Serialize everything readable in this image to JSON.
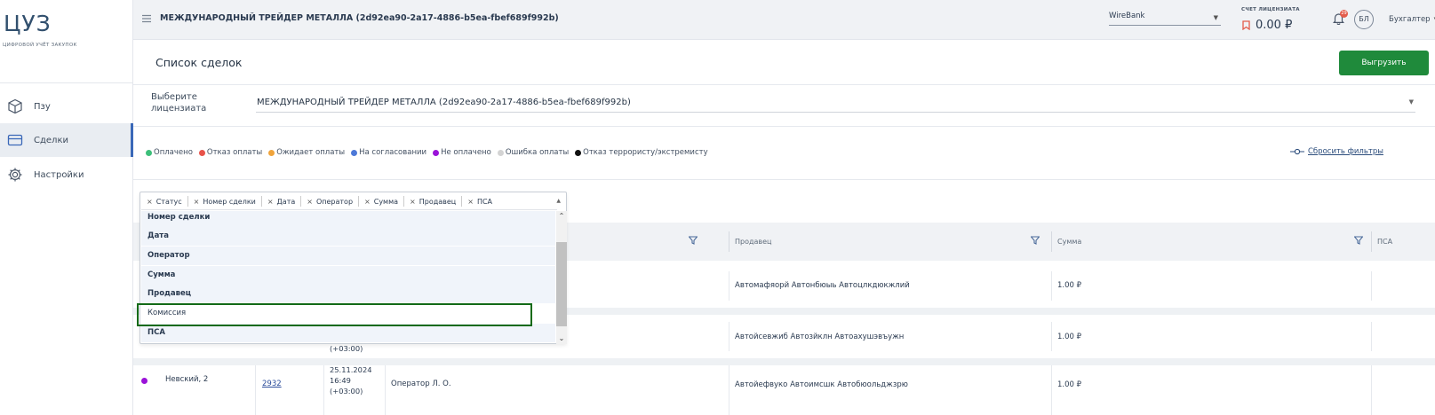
{
  "brand": {
    "logo": "ЦУЗ",
    "subtitle": "ЦИФРОВОЙ УЧЁТ ЗАКУПОК"
  },
  "sidebar": {
    "items": [
      {
        "label": "Пзу",
        "icon": "box-icon",
        "active": false
      },
      {
        "label": "Сделки",
        "icon": "card-icon",
        "active": true
      },
      {
        "label": "Настройки",
        "icon": "gear-icon",
        "active": false
      }
    ]
  },
  "header": {
    "org": "МЕЖДУНАРОДНЫЙ ТРЕЙДЕР МЕТАЛЛА (2d92ea90-2a17-4886-b5ea-fbef689f992b)",
    "bank": "WireBank",
    "license_label": "СЧЕТ ЛИЦЕНЗИАТА",
    "license_amount": "0.00 ₽",
    "notif_count": "29",
    "avatar": "БЛ",
    "role": "Бухгалтер"
  },
  "page": {
    "title": "Список сделок",
    "export_label": "Выгрузить",
    "licensee_label": "Выберите лицензиата",
    "licensee_value": "МЕЖДУНАРОДНЫЙ ТРЕЙДЕР МЕТАЛЛА (2d92ea90-2a17-4886-b5ea-fbef689f992b)",
    "reset_filters": "Сбросить фильтры"
  },
  "legend": [
    {
      "label": "Оплачено",
      "color": "#3dbf7a"
    },
    {
      "label": "Отказ оплаты",
      "color": "#e8534a"
    },
    {
      "label": "Ожидает оплаты",
      "color": "#f0a43c"
    },
    {
      "label": "На согласовании",
      "color": "#4d79d8"
    },
    {
      "label": "Не оплачено",
      "color": "#9a12d8"
    },
    {
      "label": "Ошибка оплаты",
      "color": "#d3d3d3"
    },
    {
      "label": "Отказ террористу/экстремисту",
      "color": "#111111"
    }
  ],
  "columns_dropdown": {
    "chips": [
      "Статус",
      "Номер сделки",
      "Дата",
      "Оператор",
      "Сумма",
      "Продавец",
      "ПСА"
    ],
    "options": [
      {
        "label": "Номер сделки",
        "selected": true
      },
      {
        "label": "Дата",
        "selected": true
      },
      {
        "label": "Оператор",
        "selected": true
      },
      {
        "label": "Сумма",
        "selected": true
      },
      {
        "label": "Продавец",
        "selected": true
      },
      {
        "label": "Комиссия",
        "selected": false
      },
      {
        "label": "ПСА",
        "selected": true
      }
    ]
  },
  "table": {
    "headers": {
      "seller": "Продавец",
      "sum": "Сумма",
      "psa": "ПСА"
    },
    "rows": [
      {
        "seller": "Автомафяорй Автонбюыь Автоцлкдюкжлий",
        "sum": "1.00 ₽"
      },
      {
        "date_tz": "(+03:00)",
        "seller": "Автойсевжиб Автозйклн Автоахушэвъужн",
        "sum": "1.00 ₽"
      },
      {
        "status_color": "#9a12d8",
        "address": "Невский, 2",
        "number": "2932",
        "date": "25.11.2024",
        "time": "16:49",
        "date_tz": "(+03:00)",
        "operator": "Оператор Л. О.",
        "seller": "Автойефвуко Автоимсшк Автобюольджзрю",
        "sum": "1.00 ₽"
      }
    ]
  }
}
